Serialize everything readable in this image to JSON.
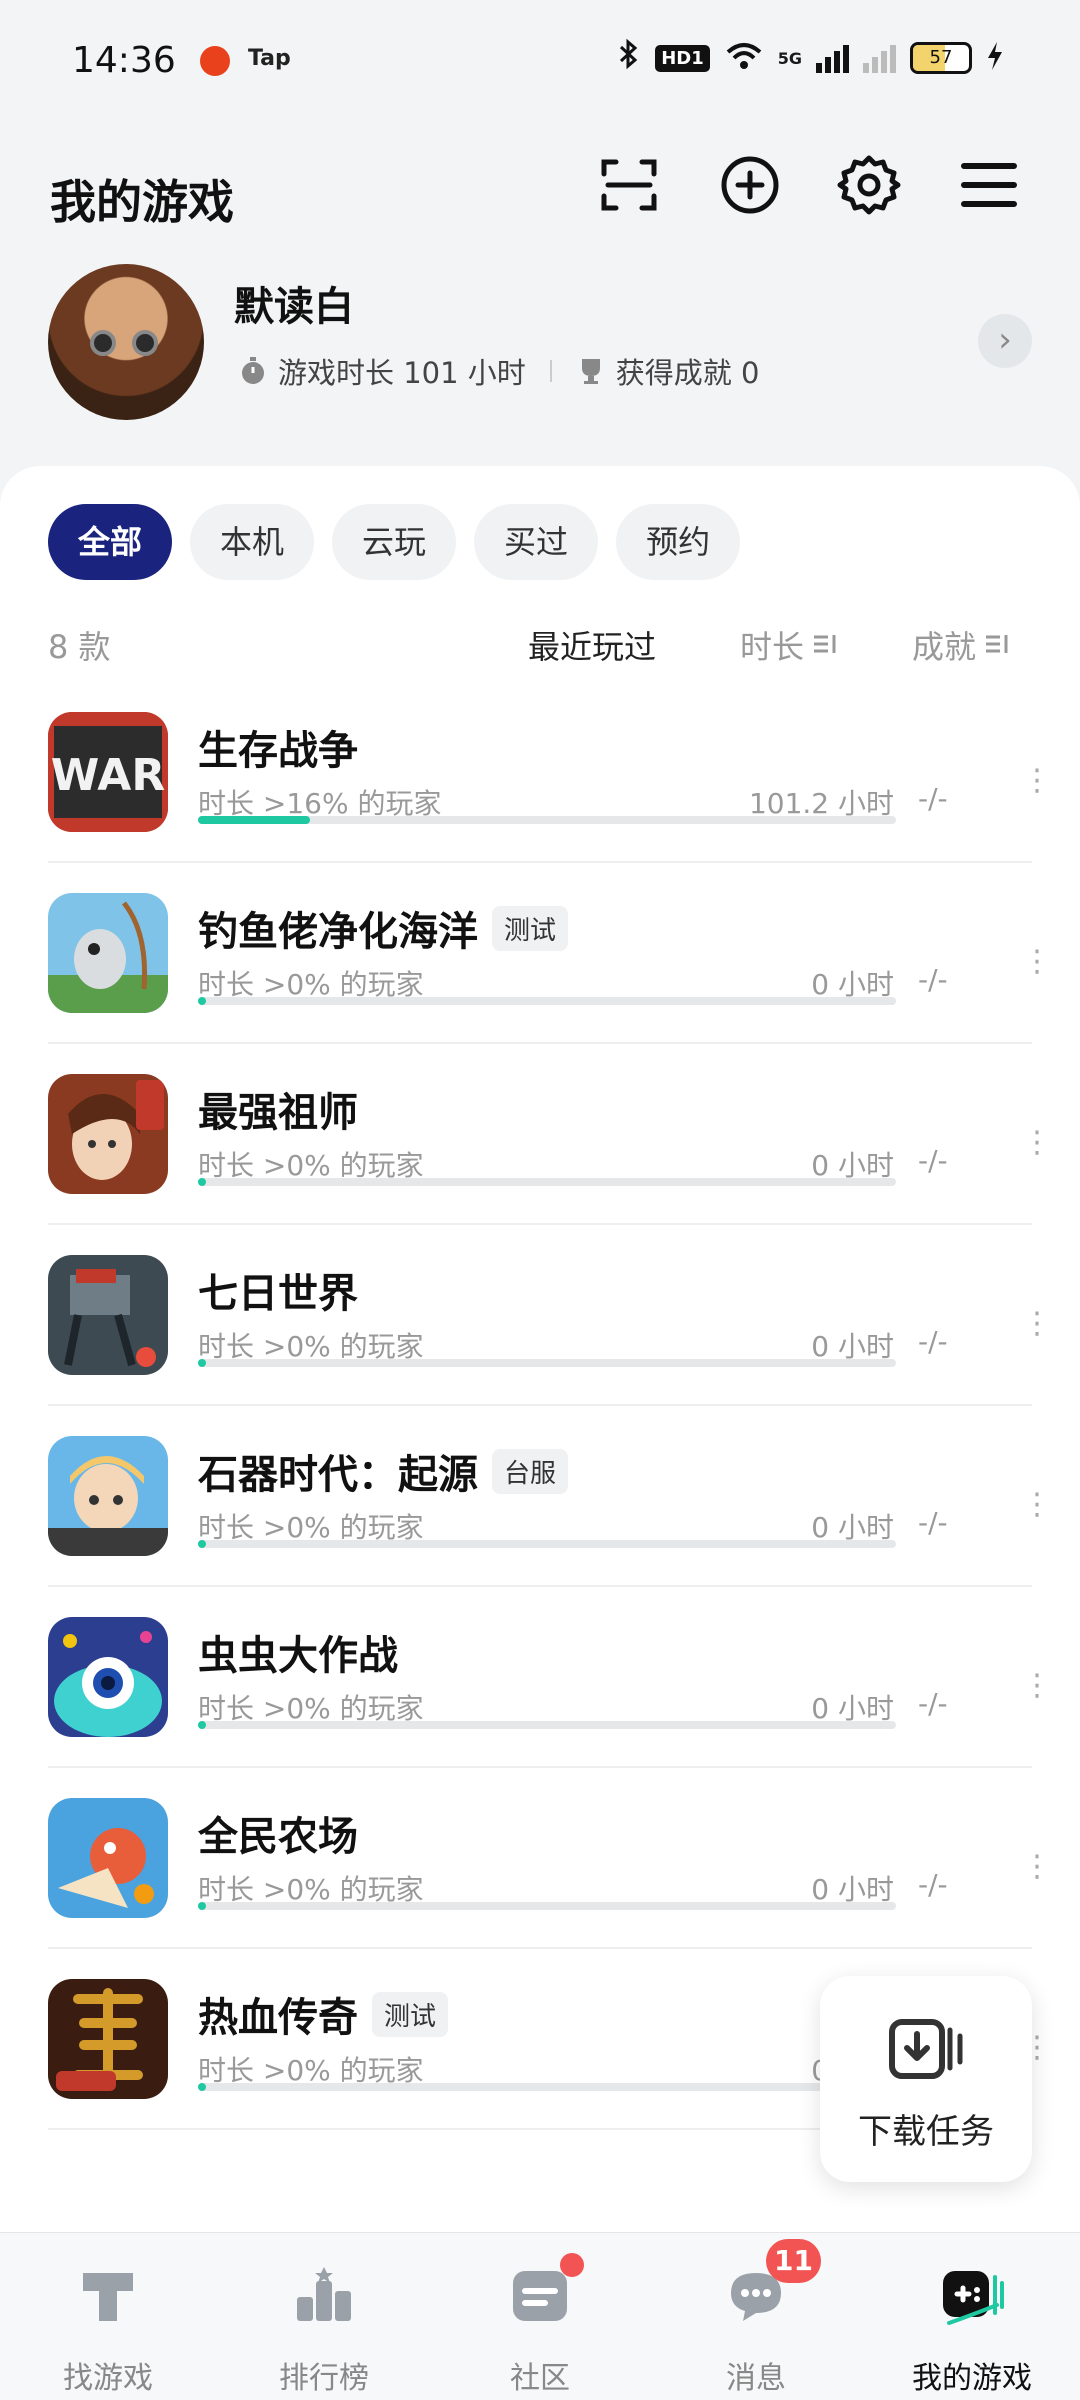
{
  "status_bar": {
    "time": "14:36",
    "app_label": "Tap",
    "hd_label": "HD1",
    "network_label": "5G",
    "battery": "57"
  },
  "header": {
    "title": "我的游戏",
    "icons": [
      "scan-icon",
      "add-circle-icon",
      "settings-gear-icon",
      "menu-icon"
    ]
  },
  "profile": {
    "username": "默读白",
    "playtime": "游戏时长 101 小时",
    "achievements": "获得成就 0"
  },
  "filters": [
    {
      "label": "全部",
      "active": true
    },
    {
      "label": "本机",
      "active": false
    },
    {
      "label": "云玩",
      "active": false
    },
    {
      "label": "买过",
      "active": false
    },
    {
      "label": "预约",
      "active": false
    }
  ],
  "list_header": {
    "count": "8 款",
    "sort_recent": "最近玩过",
    "sort_duration": "时长",
    "sort_achievement": "成就"
  },
  "games": [
    {
      "name": "生存战争",
      "tag": "",
      "subtitle": "时长 >16% 的玩家",
      "hours": "101.2 小时",
      "achievement": "-/-",
      "progress": 0.16,
      "icon_colors": [
        "#c0392b",
        "#2c2c2c"
      ]
    },
    {
      "name": "钓鱼佬净化海洋",
      "tag": "测试",
      "subtitle": "时长 >0% 的玩家",
      "hours": "0 小时",
      "achievement": "-/-",
      "progress": 0.0,
      "icon_colors": [
        "#7fc3e8",
        "#5a9e4b"
      ]
    },
    {
      "name": "最强祖师",
      "tag": "",
      "subtitle": "时长 >0% 的玩家",
      "hours": "0 小时",
      "achievement": "-/-",
      "progress": 0.0,
      "icon_colors": [
        "#c96a3d",
        "#f2d2b6"
      ]
    },
    {
      "name": "七日世界",
      "tag": "",
      "subtitle": "时长 >0% 的玩家",
      "hours": "0 小时",
      "achievement": "-/-",
      "progress": 0.0,
      "icon_colors": [
        "#3d4a52",
        "#8a9aa3"
      ]
    },
    {
      "name": "石器时代：起源",
      "tag": "台服",
      "subtitle": "时长 >0% 的玩家",
      "hours": "0 小时",
      "achievement": "-/-",
      "progress": 0.0,
      "icon_colors": [
        "#69b7e8",
        "#f4c86a"
      ]
    },
    {
      "name": "虫虫大作战",
      "tag": "",
      "subtitle": "时长 >0% 的玩家",
      "hours": "0 小时",
      "achievement": "-/-",
      "progress": 0.0,
      "icon_colors": [
        "#2c3e8f",
        "#3fd0d0"
      ]
    },
    {
      "name": "全民农场",
      "tag": "",
      "subtitle": "时长 >0% 的玩家",
      "hours": "0 小时",
      "achievement": "-/-",
      "progress": 0.0,
      "icon_colors": [
        "#4aa3df",
        "#e85d3a"
      ]
    },
    {
      "name": "热血传奇",
      "tag": "测试",
      "subtitle": "时长 >0% 的玩家",
      "hours": "0 小时",
      "achievement": "-/-",
      "progress": 0.0,
      "icon_colors": [
        "#3a1d10",
        "#d49a2a"
      ]
    }
  ],
  "download_task": {
    "label": "下载任务"
  },
  "bottom_nav": [
    {
      "label": "找游戏",
      "icon": "find-game-icon",
      "active": false,
      "badge": ""
    },
    {
      "label": "排行榜",
      "icon": "ranking-icon",
      "active": false,
      "badge": ""
    },
    {
      "label": "社区",
      "icon": "community-icon",
      "active": false,
      "badge": "dot"
    },
    {
      "label": "消息",
      "icon": "message-icon",
      "active": false,
      "badge": "11"
    },
    {
      "label": "我的游戏",
      "icon": "my-games-icon",
      "active": true,
      "badge": ""
    }
  ],
  "colors": {
    "accent": "#1a237e",
    "progress": "#1ec9a2",
    "badge": "#f25353"
  }
}
